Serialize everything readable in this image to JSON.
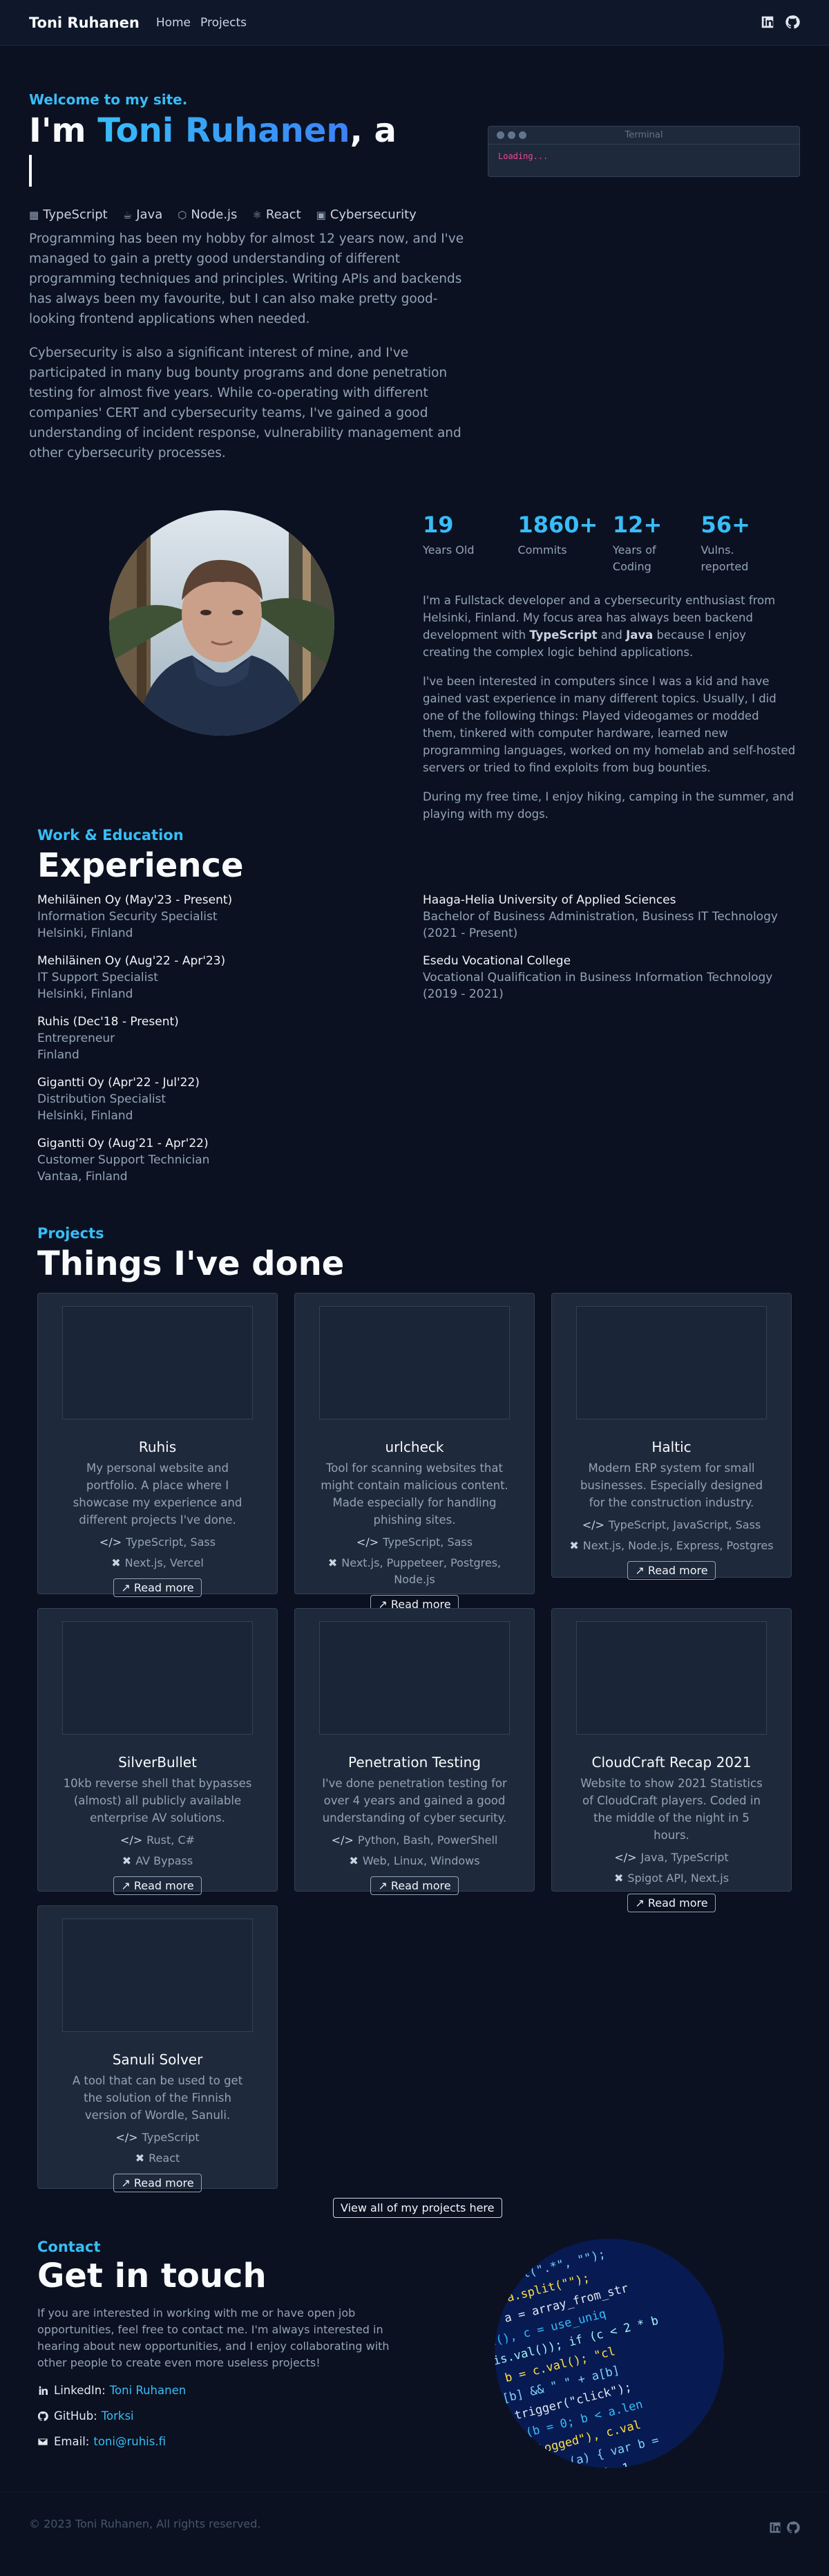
{
  "nav": {
    "brand": "Toni Ruhanen",
    "links": [
      "Home",
      "Projects"
    ],
    "icons": [
      "linkedin-icon",
      "github-icon"
    ]
  },
  "hero": {
    "kicker": "Welcome to my site.",
    "headline_prefix": "I'm ",
    "headline_name": "Toni Ruhanen",
    "headline_suffix": ", a",
    "tech": [
      "TypeScript",
      "Java",
      "Node.js",
      "React",
      "Cybersecurity"
    ],
    "paragraphs": [
      "Programming has been my hobby for almost 12 years now, and I've managed to gain a pretty good understanding of different programming techniques and principles. Writing APIs and backends has always been my favourite, but I can also make pretty good-looking frontend applications when needed.",
      "Cybersecurity is also a significant interest of mine, and I've participated in many bug bounty programs and done penetration testing for almost five years. While co-operating with different companies' CERT and cybersecurity teams, I've gained a good understanding of incident response, vulnerability management and other cybersecurity processes."
    ]
  },
  "terminal": {
    "title": "Terminal",
    "output": "Loading..."
  },
  "about": {
    "stats": [
      {
        "value": "19",
        "label": "Years Old"
      },
      {
        "value": "1860+",
        "label": "Commits"
      },
      {
        "value": "12+",
        "label": "Years of Coding"
      },
      {
        "value": "56+",
        "label": "Vulns. reported"
      }
    ],
    "p1_a": "I'm a Fullstack developer and a cybersecurity enthusiast from Helsinki, Finland. My focus area has always been backend development with ",
    "p1_b1": "TypeScript",
    "p1_and": " and ",
    "p1_b2": "Java",
    "p1_c": " because I enjoy creating the complex logic behind applications.",
    "p2": "I've been interested in computers since I was a kid and have gained vast experience in many different topics. Usually, I did one of the following things: Played videogames or modded them, tinkered with computer hardware, learned new programming languages, worked on my homelab and self-hosted servers or tried to find exploits from bug bounties.",
    "p3": "During my free time, I enjoy hiking, camping in the summer, and playing with my dogs."
  },
  "experience": {
    "kicker": "Work & Education",
    "title": "Experience",
    "work": [
      {
        "title": "Mehiläinen Oy (May'23 - Present)",
        "role": "Information Security Specialist",
        "place": "Helsinki, Finland"
      },
      {
        "title": "Mehiläinen Oy (Aug'22 - Apr'23)",
        "role": "IT Support Specialist",
        "place": "Helsinki, Finland"
      },
      {
        "title": "Ruhis (Dec'18 - Present)",
        "role": "Entrepreneur",
        "place": "Finland"
      },
      {
        "title": "Gigantti Oy (Apr'22 - Jul'22)",
        "role": "Distribution Specialist",
        "place": "Helsinki, Finland"
      },
      {
        "title": "Gigantti Oy (Aug'21 - Apr'22)",
        "role": "Customer Support Technician",
        "place": "Vantaa, Finland"
      }
    ],
    "education": [
      {
        "title": "Haaga-Helia University of Applied Sciences",
        "role": "Bachelor of Business Administration, Business IT Technology",
        "place": "(2021 - Present)"
      },
      {
        "title": "Esedu Vocational College",
        "role": "Vocational Qualification in Business Information Technology",
        "place": "(2019 - 2021)"
      }
    ]
  },
  "projects": {
    "kicker": "Projects",
    "title": "Things I've done",
    "read_more": "Read more",
    "view_all": "View all of my projects here",
    "items": [
      {
        "name": "Ruhis",
        "desc": "My personal website and portfolio. A place where I showcase my experience and different projects I've done.",
        "langs": "TypeScript, Sass",
        "tools": "Next.js, Vercel"
      },
      {
        "name": "urlcheck",
        "desc": "Tool for scanning websites that might contain malicious content. Made especially for handling phishing sites.",
        "langs": "TypeScript, Sass",
        "tools": "Next.js, Puppeteer, Postgres, Node.js"
      },
      {
        "name": "Haltic",
        "desc": "Modern ERP system for small businesses. Especially designed for the construction industry.",
        "langs": "TypeScript, JavaScript, Sass",
        "tools": "Next.js, Node.js, Express, Postgres"
      },
      {
        "name": "SilverBullet",
        "desc": "10kb reverse shell that bypasses (almost) all publicly available enterprise AV solutions.",
        "langs": "Rust, C#",
        "tools": "AV Bypass"
      },
      {
        "name": "Penetration Testing",
        "desc": "I've done penetration testing for over 4 years and gained a good understanding of cyber security.",
        "langs": "Python, Bash, PowerShell",
        "tools": "Web, Linux, Windows"
      },
      {
        "name": "CloudCraft Recap 2021",
        "desc": "Website to show 2021 Statistics of CloudCraft players. Coded in the middle of the night in 5 hours.",
        "langs": "Java, TypeScript",
        "tools": "Spigot API, Next.js"
      },
      {
        "name": "Sanuli Solver",
        "desc": "A tool that can be used to get the solution of the Finnish version of Wordle, Sanuli.",
        "langs": "TypeScript",
        "tools": "React"
      }
    ]
  },
  "contact": {
    "kicker": "Contact",
    "title": "Get in touch",
    "text": "If you are interested in working with me or have open job opportunities, feel free to contact me. I'm always interested in hearing about new opportunities, and I enjoy collaborating with other people to create even more useless projects!",
    "linkedin_label": "LinkedIn:",
    "linkedin_value": "Toni Ruhanen",
    "github_label": "GitHub:",
    "github_value": "Torksi",
    "email_label": "Email:",
    "email_value": "toni@ruhis.fi"
  },
  "footer": {
    "copyright": "© 2023 Toni Ruhanen, All rights reserved."
  }
}
